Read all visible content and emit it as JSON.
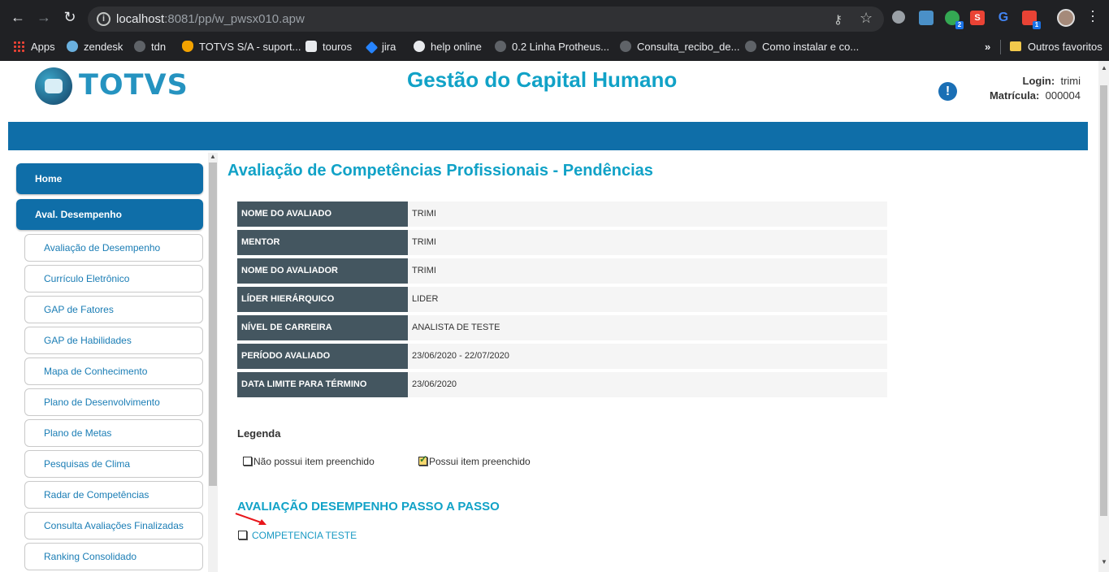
{
  "browser": {
    "url_host": "localhost",
    "url_rest": ":8081/pp/w_pwsx010.apw",
    "extensions": [
      {
        "name": "ext-1",
        "color": "#9aa0a6"
      },
      {
        "name": "ext-2",
        "color": "#4a90c8"
      },
      {
        "name": "ext-3",
        "color": "#34a853",
        "badge": "2"
      },
      {
        "name": "ext-4",
        "color": "#ea4335",
        "label": "S"
      },
      {
        "name": "ext-5",
        "color": "#4285f4",
        "label": "G"
      },
      {
        "name": "ext-6",
        "color": "#e94335",
        "badge": "1"
      }
    ],
    "bookmarks": [
      {
        "label": "Apps"
      },
      {
        "label": "zendesk"
      },
      {
        "label": "tdn"
      },
      {
        "label": "TOTVS S/A - suport..."
      },
      {
        "label": "touros"
      },
      {
        "label": "jira"
      },
      {
        "label": "help online"
      },
      {
        "label": "0.2 Linha Protheus..."
      },
      {
        "label": "Consulta_recibo_de..."
      },
      {
        "label": "Como instalar e co..."
      }
    ],
    "more": "»",
    "other_bookmarks": "Outros favoritos"
  },
  "header": {
    "logo_text": "TOTVS",
    "title": "Gestão do Capital Humano",
    "login_label": "Login:",
    "login_value": "trimi",
    "matricula_label": "Matrícula:",
    "matricula_value": "000004"
  },
  "sidebar": {
    "main_items": [
      {
        "label": "Home"
      },
      {
        "label": "Aval. Desempenho"
      }
    ],
    "sub_items": [
      {
        "label": "Avaliação de Desempenho"
      },
      {
        "label": "Currículo Eletrônico"
      },
      {
        "label": "GAP de Fatores"
      },
      {
        "label": "GAP de Habilidades"
      },
      {
        "label": "Mapa de Conhecimento"
      },
      {
        "label": "Plano de Desenvolvimento"
      },
      {
        "label": "Plano de Metas"
      },
      {
        "label": "Pesquisas de Clima"
      },
      {
        "label": "Radar de Competências"
      },
      {
        "label": "Consulta Avaliações Finalizadas"
      },
      {
        "label": "Ranking Consolidado"
      }
    ]
  },
  "main": {
    "heading": "Avaliação de Competências Profissionais - Pendências",
    "info": [
      {
        "key": "NOME DO AVALIADO",
        "value": "TRIMI"
      },
      {
        "key": "MENTOR",
        "value": "TRIMI"
      },
      {
        "key": "NOME DO AVALIADOR",
        "value": "TRIMI"
      },
      {
        "key": "LÍDER HIERÁRQUICO",
        "value": "LIDER"
      },
      {
        "key": "NÍVEL DE CARREIRA",
        "value": "ANALISTA DE TESTE"
      },
      {
        "key": "PERÍODO AVALIADO",
        "value": "23/06/2020 - 22/07/2020"
      },
      {
        "key": "DATA LIMITE PARA TÉRMINO",
        "value": "23/06/2020"
      }
    ],
    "legend_title": "Legenda",
    "legend_empty": "Não possui item preenchido",
    "legend_filled": "Possui item preenchido",
    "section_title": "AVALIAÇÃO DESEMPENHO PASSO A PASSO",
    "competency_link": "COMPETENCIA TESTE"
  },
  "colors": {
    "accent": "#11a2c7",
    "nav_blue": "#0f6ea8",
    "key_cell": "#445660",
    "annotation_arrow": "#e8161b"
  }
}
